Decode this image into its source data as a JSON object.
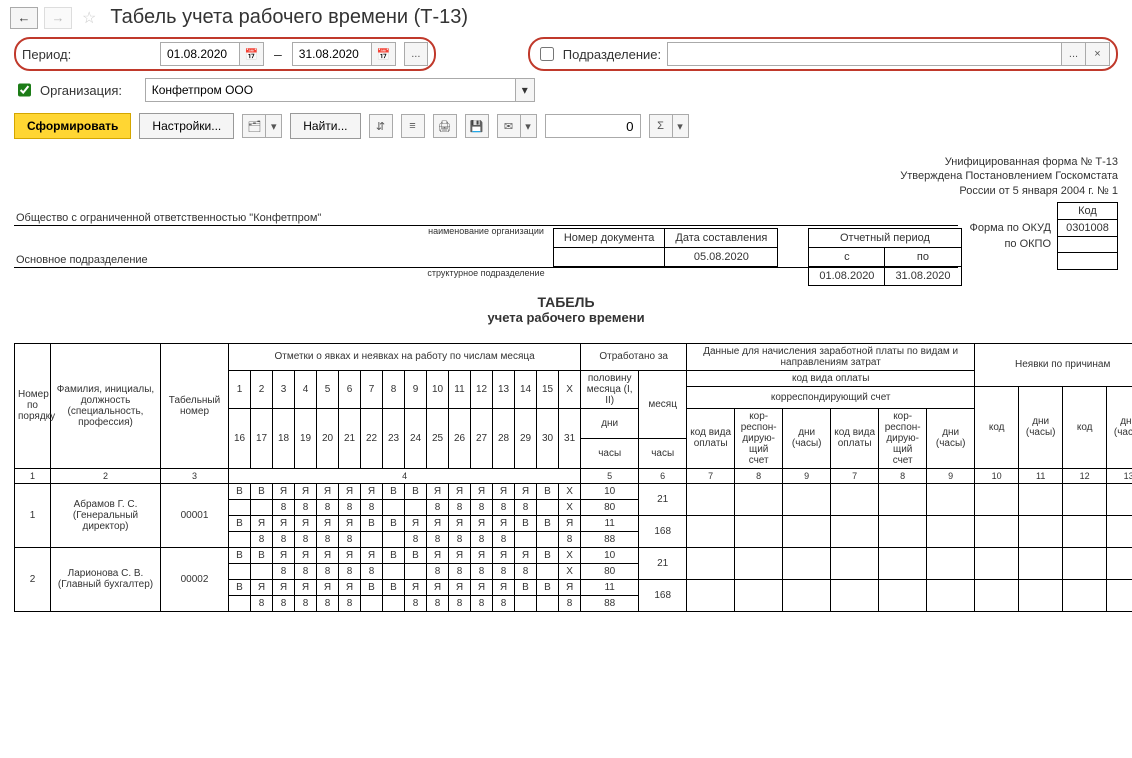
{
  "header": {
    "title": "Табель учета рабочего времени (Т-13)"
  },
  "filters": {
    "period_label": "Период:",
    "date_from": "01.08.2020",
    "date_to": "31.08.2020",
    "dept_label": "Подразделение:",
    "dept_value": "",
    "org_label": "Организация:",
    "org_value": "Конфетпром ООО"
  },
  "toolbar": {
    "generate": "Сформировать",
    "settings": "Настройки...",
    "find": "Найти...",
    "num_value": "0"
  },
  "report": {
    "form_line1": "Унифицированная форма № Т-13",
    "form_line2": "Утверждена Постановлением Госкомстата",
    "form_line3": "России от 5 января 2004 г. № 1",
    "kod_label": "Код",
    "okud_label": "Форма по ОКУД",
    "okud_value": "0301008",
    "okpo_label": "по ОКПО",
    "okpo_value": "",
    "org_name": "Общество с ограниченной ответственностью \"Конфетпром\"",
    "org_sub": "наименование организации",
    "dept_name": "Основное подразделение",
    "dept_sub": "структурное подразделение",
    "doc_num_label": "Номер документа",
    "doc_num": "",
    "doc_date_label": "Дата составления",
    "doc_date": "05.08.2020",
    "period_label": "Отчетный период",
    "period_from_label": "с",
    "period_to_label": "по",
    "period_from": "01.08.2020",
    "period_to": "31.08.2020",
    "title1": "ТАБЕЛЬ",
    "title2": "учета  рабочего времени"
  },
  "headers": {
    "idx": "Номер по порядку",
    "fio": "Фамилия, инициалы, должность (специальность, профессия)",
    "tab": "Табельный номер",
    "marks": "Отметки о явках и неявках на работу по числам месяца",
    "days_top": [
      "1",
      "2",
      "3",
      "4",
      "5",
      "6",
      "7",
      "8",
      "9",
      "10",
      "11",
      "12",
      "13",
      "14",
      "15",
      "X"
    ],
    "days_bot": [
      "16",
      "17",
      "18",
      "19",
      "20",
      "21",
      "22",
      "23",
      "24",
      "25",
      "26",
      "27",
      "28",
      "29",
      "30",
      "31"
    ],
    "worked": "Отработано за",
    "half": "половину месяца (I, II)",
    "month": "месяц",
    "days": "дни",
    "hours": "часы",
    "payroll": "Данные для начисления заработной платы по видам и направлениям затрат",
    "pay_code": "код вида оплаты",
    "corr": "корреспондирующий счет",
    "p_code": "код вида оплаты",
    "p_corr": "кор-респон-дирую-щий счет",
    "p_dh": "дни (часы)",
    "absence": "Неявки по причинам",
    "a_code": "код",
    "a_dh": "дни (часы)"
  },
  "colnums": [
    "1",
    "2",
    "3",
    "4",
    "5",
    "6",
    "7",
    "8",
    "9",
    "7",
    "8",
    "9",
    "10",
    "11",
    "12",
    "13"
  ],
  "rows": [
    {
      "idx": "1",
      "fio": "Абрамов Г. С. (Генеральный директор)",
      "tab": "00001",
      "marks1": [
        "В",
        "В",
        "Я",
        "Я",
        "Я",
        "Я",
        "Я",
        "В",
        "В",
        "Я",
        "Я",
        "Я",
        "Я",
        "Я",
        "В",
        "X"
      ],
      "hours1": [
        "",
        "",
        "8",
        "8",
        "8",
        "8",
        "8",
        "",
        "",
        "8",
        "8",
        "8",
        "8",
        "8",
        "",
        "X"
      ],
      "marks2": [
        "В",
        "Я",
        "Я",
        "Я",
        "Я",
        "Я",
        "В",
        "В",
        "Я",
        "Я",
        "Я",
        "Я",
        "Я",
        "В",
        "В",
        "Я"
      ],
      "hours2": [
        "",
        "8",
        "8",
        "8",
        "8",
        "8",
        "",
        "",
        "8",
        "8",
        "8",
        "8",
        "8",
        "",
        "",
        "8"
      ],
      "half": [
        "10",
        "80",
        "11",
        "88"
      ],
      "month": [
        "21",
        "168"
      ]
    },
    {
      "idx": "2",
      "fio": "Ларионова С. В. (Главный бухгалтер)",
      "tab": "00002",
      "marks1": [
        "В",
        "В",
        "Я",
        "Я",
        "Я",
        "Я",
        "Я",
        "В",
        "В",
        "Я",
        "Я",
        "Я",
        "Я",
        "Я",
        "В",
        "X"
      ],
      "hours1": [
        "",
        "",
        "8",
        "8",
        "8",
        "8",
        "8",
        "",
        "",
        "8",
        "8",
        "8",
        "8",
        "8",
        "",
        "X"
      ],
      "marks2": [
        "В",
        "Я",
        "Я",
        "Я",
        "Я",
        "Я",
        "В",
        "В",
        "Я",
        "Я",
        "Я",
        "Я",
        "Я",
        "В",
        "В",
        "Я"
      ],
      "hours2": [
        "",
        "8",
        "8",
        "8",
        "8",
        "8",
        "",
        "",
        "8",
        "8",
        "8",
        "8",
        "8",
        "",
        "",
        "8"
      ],
      "half": [
        "10",
        "80",
        "11",
        "88"
      ],
      "month": [
        "21",
        "168"
      ]
    }
  ]
}
